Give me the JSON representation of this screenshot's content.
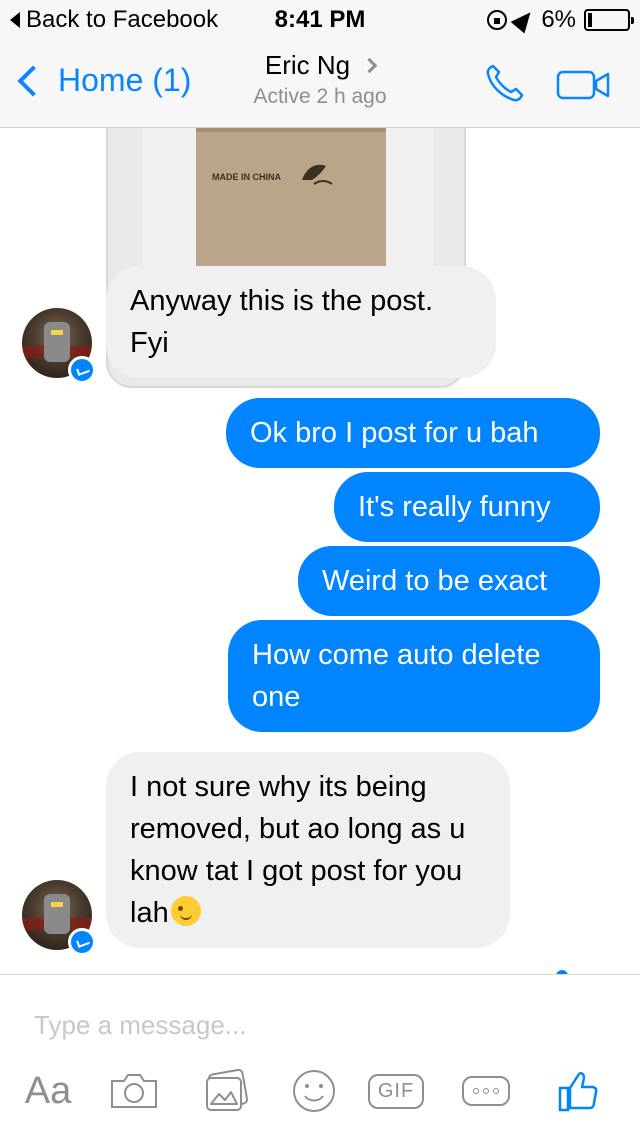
{
  "status_bar": {
    "back_label": "Back to Facebook",
    "time": "8:41 PM",
    "battery": "6%"
  },
  "nav": {
    "back_label": "Home (1)",
    "title": "Eric Ng",
    "subtitle": "Active 2 h ago"
  },
  "photo": {
    "box_text": "MADE IN CHINA"
  },
  "messages": [
    {
      "sender": "contact",
      "text": "Anyway this is the post. Fyi"
    },
    {
      "sender": "me",
      "text": "Ok bro I post for u bah"
    },
    {
      "sender": "me",
      "text": "It's really funny"
    },
    {
      "sender": "me",
      "text": "Weird to be exact"
    },
    {
      "sender": "me",
      "text": "How come auto delete one"
    },
    {
      "sender": "contact",
      "text": "I not sure why its being removed,  but ao long as u know tat I got post for you lah"
    }
  ],
  "composer": {
    "placeholder": "Type a message...",
    "aa_label": "Aa",
    "gif_label": "GIF"
  },
  "colors": {
    "accent": "#0084ff",
    "incoming_bubble": "#f1f0f0",
    "bar_background": "#f7f7f7",
    "icon_gray": "#8e8e93"
  }
}
